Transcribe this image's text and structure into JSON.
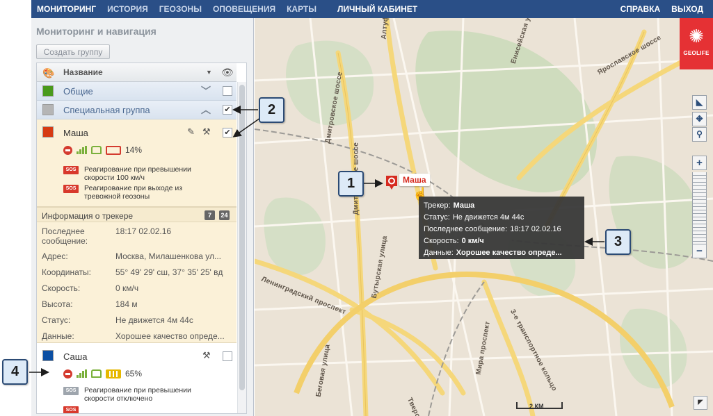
{
  "nav": {
    "items": [
      "МОНИТОРИНГ",
      "ИСТОРИЯ",
      "ГЕОЗОНЫ",
      "ОПОВЕЩЕНИЯ",
      "КАРТЫ",
      "ЛИЧНЫЙ КАБИНЕТ"
    ],
    "right": [
      "СПРАВКА",
      "ВЫХОД"
    ]
  },
  "sidebar": {
    "title": "Мониторинг и навигация",
    "create_group": "Создать группу",
    "header": {
      "name": "Название"
    },
    "groups": [
      {
        "name": "Общие",
        "color": "#4a9a1c"
      },
      {
        "name": "Специальная группа",
        "color": "#b5b5b5",
        "checked": "✔"
      }
    ],
    "trackers": [
      {
        "name": "Маша",
        "color": "#d63a12",
        "battery": "14%",
        "checked": "✔",
        "alerts": [
          "Реагирование при превышении скорости 100 км/ч",
          "Реагирование при выходе из тревожной геозоны"
        ]
      },
      {
        "name": "Саша",
        "color": "#0b4fa3",
        "battery": "65%",
        "alerts": [
          "Реагирование при превышении скорости отключено"
        ]
      }
    ],
    "sos_label": "SOS",
    "info": {
      "title": "Информация о трекере",
      "badge_7": "7",
      "badge_24": "24",
      "rows": [
        {
          "k": "Последнее сообщение:",
          "v": "18:17 02.02.16"
        },
        {
          "k": "Адрес:",
          "v": "Москва, Милашенкова ул..."
        },
        {
          "k": "Координаты:",
          "v": "55° 49' 29' сш, 37° 35' 25' вд"
        },
        {
          "k": "Скорость:",
          "v": "0 км/ч"
        },
        {
          "k": "Высота:",
          "v": "184 м"
        },
        {
          "k": "Статус:",
          "v": "Не движется 4м 44с"
        },
        {
          "k": "Данные:",
          "v": "Хорошее качество опреде..."
        }
      ]
    }
  },
  "map": {
    "logo": "GEOLIFE",
    "marker_label": "Маша",
    "scale": "2 КМ",
    "streets": [
      "Дмитровское шоссе",
      "Алтуфьевское",
      "Енисейская улица",
      "Ярославское шоссе",
      "Ленинградский проспект",
      "Бутырская улица",
      "Дмитровское шоссе",
      "Беговая улица",
      "Мира проспект",
      "3-е транспортное кольцо",
      "Тверская"
    ],
    "tooltip": [
      {
        "k": "Трекер:",
        "v": "Маша"
      },
      {
        "k": "Статус:",
        "v": "Не движется 4м 44с"
      },
      {
        "k": "Последнее сообщение:",
        "v": "18:17 02.02.16"
      },
      {
        "k": "Скорость:",
        "v": "0 км/ч"
      },
      {
        "k": "Данные:",
        "v": "Хорошее качество опреде..."
      }
    ],
    "accent": "#e53134"
  },
  "callouts": [
    "1",
    "2",
    "3",
    "4"
  ]
}
